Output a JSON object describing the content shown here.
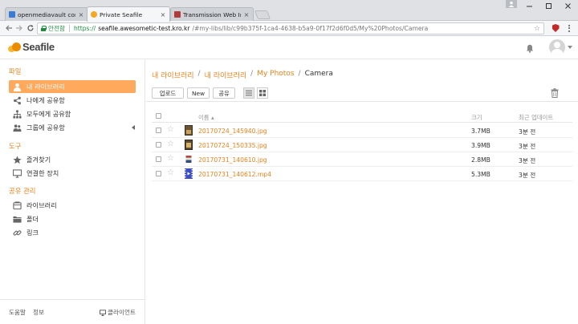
{
  "browser": {
    "tabs": [
      {
        "title": "openmediavault contro",
        "favicon_color": "#3a7bd5",
        "active": false
      },
      {
        "title": "Private Seafile",
        "favicon_color": "#f5a623",
        "active": true
      },
      {
        "title": "Transmission Web Inter",
        "favicon_color": "#b23a3a",
        "active": false
      }
    ],
    "close_glyph": "×",
    "secure_label": "안전함",
    "url_protocol": "https://",
    "url_host": "seafile.awesometic-test.kro.kr",
    "url_path": "/#my-libs/lib/c99b375f-1ca4-4638-b5a9-0f17f2d6f0d5/My%20Photos/Camera"
  },
  "header": {
    "logo_text": "Seafile"
  },
  "sidebar": {
    "sections": [
      {
        "title": "파일",
        "items": [
          {
            "label": "내 라이브러리",
            "icon": "user-icon",
            "active": true
          },
          {
            "label": "나에게 공유함",
            "icon": "share-icon",
            "active": false
          },
          {
            "label": "모두에게 공유함",
            "icon": "org-icon",
            "active": false
          },
          {
            "label": "그룹에 공유함",
            "icon": "group-icon",
            "active": false
          }
        ]
      },
      {
        "title": "도구",
        "items": [
          {
            "label": "즐겨찾기",
            "icon": "star-icon",
            "active": false
          },
          {
            "label": "연결한 장치",
            "icon": "monitor-icon",
            "active": false
          }
        ]
      },
      {
        "title": "공유 관리",
        "items": [
          {
            "label": "라이브러리",
            "icon": "library-icon",
            "active": false
          },
          {
            "label": "폴더",
            "icon": "folder-icon",
            "active": false
          },
          {
            "label": "링크",
            "icon": "link-icon",
            "active": false
          }
        ]
      }
    ],
    "footer": {
      "help": "도움말",
      "info": "정보",
      "clients": "클라이언트"
    }
  },
  "main": {
    "breadcrumb": [
      {
        "label": "내 라이브러리",
        "link": true
      },
      {
        "label": "내 라이브러리",
        "link": true
      },
      {
        "label": "My Photos",
        "link": true
      },
      {
        "label": "Camera",
        "link": false
      }
    ],
    "breadcrumb_sep": "/",
    "buttons": {
      "upload": "업로드",
      "new": "New",
      "share": "공유"
    },
    "columns": {
      "name": "이름 ▴",
      "size": "크기",
      "updated": "최근 업데이트"
    },
    "files": [
      {
        "name": "20170724_145940.jpg",
        "size": "3.7MB",
        "updated": "3분 전",
        "thumb": "photo-dark"
      },
      {
        "name": "20170724_150335.jpg",
        "size": "3.9MB",
        "updated": "3분 전",
        "thumb": "photo-dark"
      },
      {
        "name": "20170731_140610.jpg",
        "size": "2.8MB",
        "updated": "3분 전",
        "thumb": "photo-flag"
      },
      {
        "name": "20170731_140612.mp4",
        "size": "5.3MB",
        "updated": "3분 전",
        "thumb": "video"
      }
    ]
  }
}
